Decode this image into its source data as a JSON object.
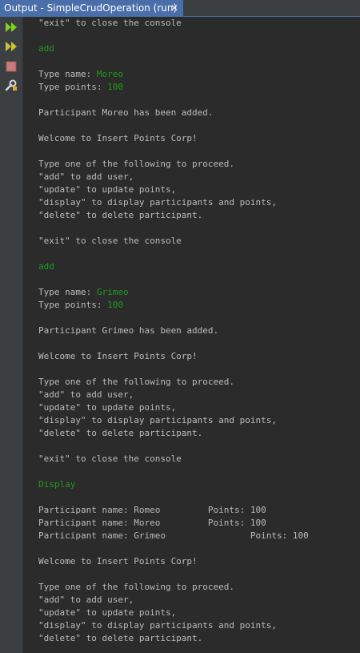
{
  "tab": {
    "title": "Output - SimpleCrudOperation (run)",
    "close_glyph": "✕"
  },
  "toolbar": [
    {
      "icon": "rerun-icon"
    },
    {
      "icon": "rerun-with-options-icon"
    },
    {
      "icon": "stop-icon"
    },
    {
      "icon": "settings-icon"
    }
  ],
  "colors": {
    "background": "#2b2b2b",
    "text": "#bbbbbb",
    "input": "#1f9a1f",
    "tab_active": "#4a6ea9"
  },
  "console": {
    "lines": [
      {
        "text": "\"exit\" to close the console"
      },
      {
        "text": ""
      },
      {
        "text": "add",
        "input": true
      },
      {
        "text": ""
      },
      {
        "prefix": "Type name: ",
        "input_text": "Moreo"
      },
      {
        "prefix": "Type points: ",
        "input_text": "100"
      },
      {
        "text": ""
      },
      {
        "text": "Participant Moreo has been added."
      },
      {
        "text": ""
      },
      {
        "text": "Welcome to Insert Points Corp!"
      },
      {
        "text": ""
      },
      {
        "text": "Type one of the following to proceed."
      },
      {
        "text": "\"add\" to add user,"
      },
      {
        "text": "\"update\" to update points,"
      },
      {
        "text": "\"display\" to display participants and points,"
      },
      {
        "text": "\"delete\" to delete participant."
      },
      {
        "text": ""
      },
      {
        "text": "\"exit\" to close the console"
      },
      {
        "text": ""
      },
      {
        "text": "add",
        "input": true
      },
      {
        "text": ""
      },
      {
        "prefix": "Type name: ",
        "input_text": "Grimeo"
      },
      {
        "prefix": "Type points: ",
        "input_text": "100"
      },
      {
        "text": ""
      },
      {
        "text": "Participant Grimeo has been added."
      },
      {
        "text": ""
      },
      {
        "text": "Welcome to Insert Points Corp!"
      },
      {
        "text": ""
      },
      {
        "text": "Type one of the following to proceed."
      },
      {
        "text": "\"add\" to add user,"
      },
      {
        "text": "\"update\" to update points,"
      },
      {
        "text": "\"display\" to display participants and points,"
      },
      {
        "text": "\"delete\" to delete participant."
      },
      {
        "text": ""
      },
      {
        "text": "\"exit\" to close the console"
      },
      {
        "text": ""
      },
      {
        "text": "Display",
        "input": true
      },
      {
        "text": ""
      },
      {
        "text": "Participant name: Romeo         Points: 100"
      },
      {
        "text": "Participant name: Moreo         Points: 100"
      },
      {
        "text": "Participant name: Grimeo                Points: 100"
      },
      {
        "text": ""
      },
      {
        "text": "Welcome to Insert Points Corp!"
      },
      {
        "text": ""
      },
      {
        "text": "Type one of the following to proceed."
      },
      {
        "text": "\"add\" to add user,"
      },
      {
        "text": "\"update\" to update points,"
      },
      {
        "text": "\"display\" to display participants and points,"
      },
      {
        "text": "\"delete\" to delete participant."
      }
    ]
  }
}
